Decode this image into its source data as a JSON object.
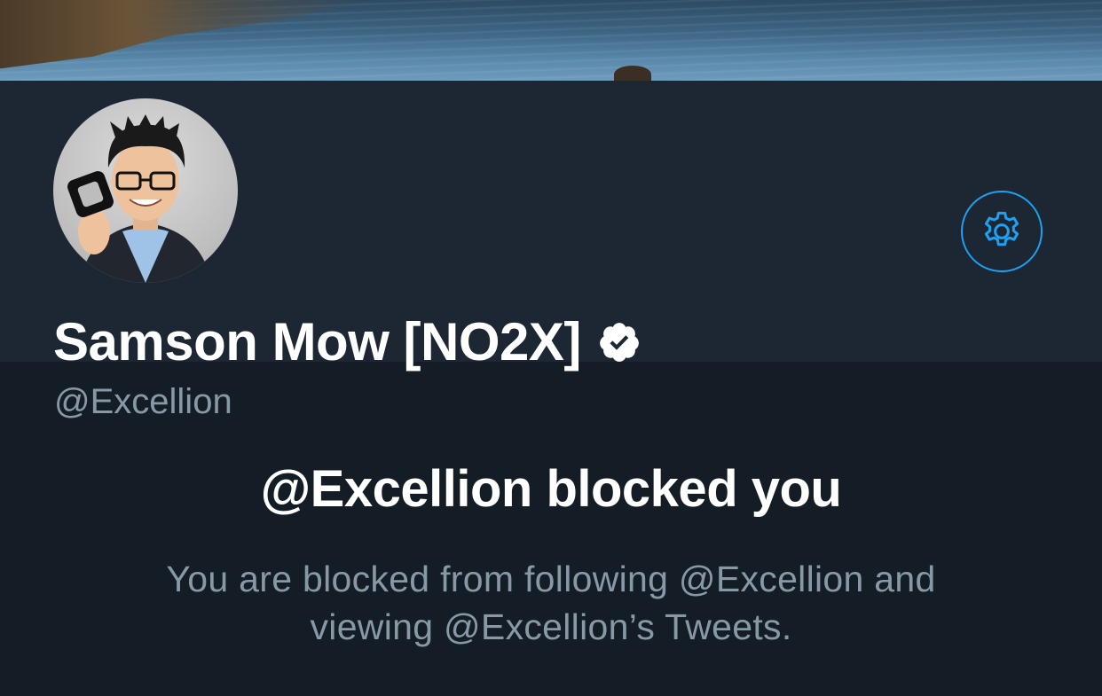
{
  "banner": {
    "image": "coastline-sea-photo"
  },
  "profile": {
    "display_name": "Samson Mow [NO2X]",
    "handle": "@Excellion",
    "verified": true,
    "avatar": "profile-photo",
    "settings_icon": "gear-icon"
  },
  "blocked": {
    "title": "@Excellion blocked you",
    "description": "You are blocked from following @Excellion and viewing @Excellion’s Tweets."
  },
  "colors": {
    "accent": "#1da1f2",
    "panel_bg": "#1c2733",
    "page_bg": "#141d26",
    "secondary_text": "#8899a6",
    "primary_text": "#ffffff"
  }
}
